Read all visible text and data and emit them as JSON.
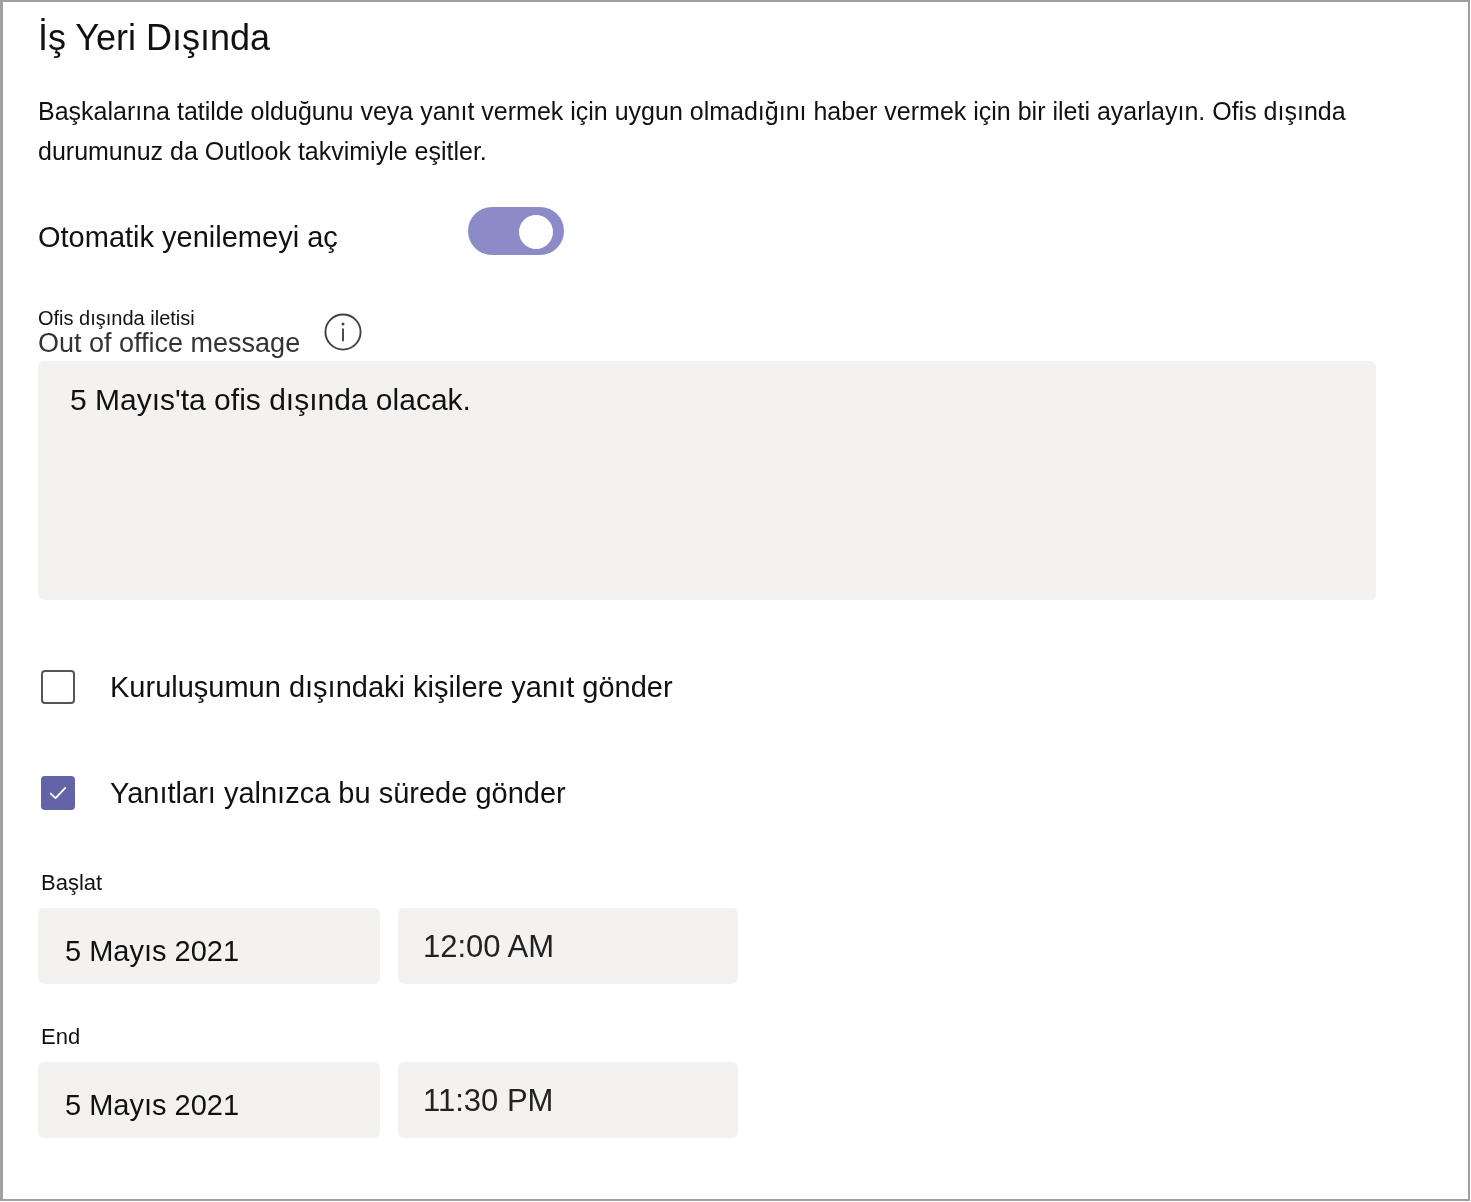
{
  "page": {
    "title": "İş Yeri Dışında",
    "description": "Başkalarına tatilde olduğunu veya yanıt vermek için uygun olmadığını haber vermek için bir ileti ayarlayın. Ofis dışında durumunuz da Outlook takvimiyle eşitler."
  },
  "auto_reply": {
    "label": "Otomatik yenilemeyi aç",
    "on": true
  },
  "message": {
    "label": "Ofis dışında iletisi",
    "label_behind": "Out of office message",
    "value": "5 Mayıs'ta ofis dışında olacak."
  },
  "options": [
    {
      "label": "Kuruluşumun dışındaki kişilere yanıt gönder",
      "checked": false
    },
    {
      "label": "Yanıtları yalnızca bu sürede gönder",
      "checked": true
    }
  ],
  "schedule": [
    {
      "label": "Başlat",
      "date": "5 Mayıs 2021",
      "time": "12:00 AM"
    },
    {
      "label": "End",
      "date": "5 Mayıs 2021",
      "time": "11:30 PM"
    }
  ]
}
